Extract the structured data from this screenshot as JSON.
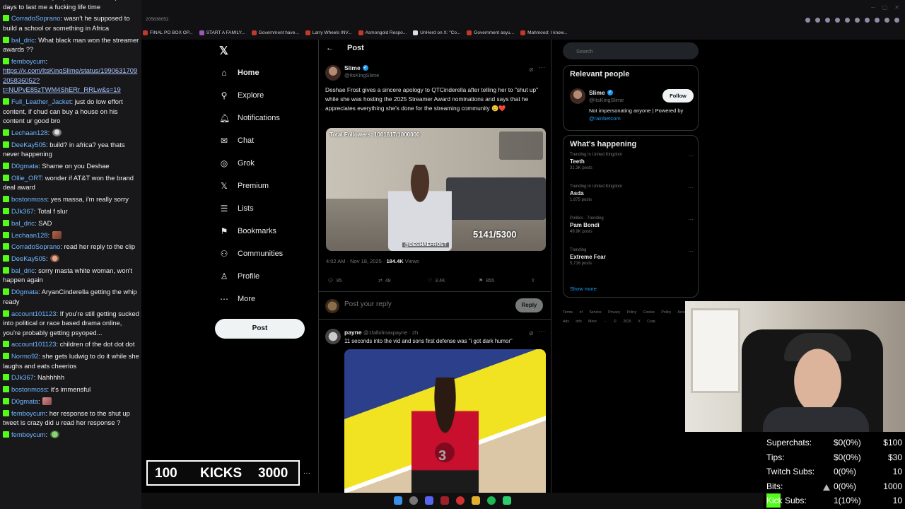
{
  "chat": {
    "messages": [
      {
        "user": "",
        "text": "obnoxious black people in the last couple days to last me a fucking life time",
        "emote": ""
      },
      {
        "user": "CorradoSoprano",
        "text": "wasn't he supposed to build a school or something in Africa",
        "emote": ""
      },
      {
        "user": "bal_dric",
        "text": "What black man won the streamer awards ??",
        "emote": ""
      },
      {
        "user": "femboycum",
        "link": "https://x.com/ItsKingSlime/status/1990631709205836052?t=NUPvE85zTWM4ShERr_RRLw&s=19",
        "text": "",
        "emote": ""
      },
      {
        "user": "Full_Leather_Jacket",
        "text": "just do low effort content, if chud can buy a house on his content ur good bro",
        "emote": ""
      },
      {
        "user": "Lechaan128",
        "text": "",
        "emote": "e1"
      },
      {
        "user": "DeeKay505",
        "text": "build? in africa? yea thats never happening",
        "emote": ""
      },
      {
        "user": "D0gmata",
        "text": "Shame on you Deshae",
        "emote": ""
      },
      {
        "user": "Ollie_ORT",
        "text": "wonder if AT&T won the brand deal award",
        "emote": ""
      },
      {
        "user": "bostonmoss",
        "text": "yes massa, i'm really sorry",
        "emote": ""
      },
      {
        "user": "DJk367",
        "text": "Total f slur",
        "emote": ""
      },
      {
        "user": "bal_dric",
        "text": "SAD",
        "emote": ""
      },
      {
        "user": "Lechaan128",
        "text": "",
        "emote": "e2"
      },
      {
        "user": "CorradoSoprano",
        "text": "read her reply to the clip",
        "emote": ""
      },
      {
        "user": "DeeKay505",
        "text": "",
        "emote": "e3"
      },
      {
        "user": "bal_dric",
        "text": "sorry masta white woman, won't happen again",
        "emote": ""
      },
      {
        "user": "D0gmata",
        "text": "AryanCinderella getting the whip ready",
        "emote": ""
      },
      {
        "user": "account101123",
        "text": "If you're still getting sucked into political or race based drama online, you're probably getting psyoped...",
        "emote": ""
      },
      {
        "user": "account101123",
        "text": "children of the dot dot dot",
        "emote": ""
      },
      {
        "user": "Normo92",
        "text": "she gets ludwig to do it while she laughs and eats cheerios",
        "emote": ""
      },
      {
        "user": "DJk367",
        "text": "Nahhhhh",
        "emote": ""
      },
      {
        "user": "bostonmoss",
        "text": "it's immensful",
        "emote": ""
      },
      {
        "user": "D0gmata",
        "text": "",
        "emote": "e4"
      },
      {
        "user": "femboycum",
        "text": "her response to the shut up tweet is crazy did u read her response ?",
        "emote": ""
      },
      {
        "user": "femboycum",
        "text": "",
        "emote": "e5"
      }
    ]
  },
  "browser": {
    "url_fragment": "205836052",
    "bookmarks": [
      {
        "label": "FINAL PO BOX OP...",
        "color": "#c0392b"
      },
      {
        "label": "START A FAMILY...",
        "color": "#9b59b6"
      },
      {
        "label": "Government have...",
        "color": "#c0392b"
      },
      {
        "label": "Larry Wheels INV...",
        "color": "#c0392b"
      },
      {
        "label": "Asmongold Respo...",
        "color": "#c0392b"
      },
      {
        "label": "UnHerd on X: \"Co...",
        "color": "#dddddd"
      },
      {
        "label": "Government asyu...",
        "color": "#c0392b"
      },
      {
        "label": "Mahmood: I know...",
        "color": "#c0392b"
      }
    ]
  },
  "nav": {
    "logo": "𝕏",
    "items": [
      {
        "label": "Home",
        "icon": "⌂",
        "name": "home"
      },
      {
        "label": "Explore",
        "icon": "⚲",
        "name": "explore"
      },
      {
        "label": "Notifications",
        "icon": "🔔︎",
        "name": "notifications"
      },
      {
        "label": "Chat",
        "icon": "✉",
        "name": "chat"
      },
      {
        "label": "Grok",
        "icon": "◎",
        "name": "grok"
      },
      {
        "label": "Premium",
        "icon": "𝕏",
        "name": "premium"
      },
      {
        "label": "Lists",
        "icon": "☰",
        "name": "lists"
      },
      {
        "label": "Bookmarks",
        "icon": "⚑",
        "name": "bookmarks"
      },
      {
        "label": "Communities",
        "icon": "⚇",
        "name": "communities"
      },
      {
        "label": "Profile",
        "icon": "♙",
        "name": "profile"
      },
      {
        "label": "More",
        "icon": "⋯",
        "name": "more"
      }
    ],
    "post_button": "Post"
  },
  "post": {
    "header": "Post",
    "back": "←",
    "author_name": "Slime",
    "author_handle": "@ItsKingSlime",
    "text": "Deshae Frost gives a sincere apology to QTCinderella after telling her to \"shut up\" while she was hosting the 2025 Streamer Award nominations and says that he appreciates everything she's done for the streaming community 😢❤️",
    "media_top": "Total Followers: 1001617/1000000",
    "media_count": "5141/5300",
    "media_tag": "@DESHAEFROST",
    "time": "4:02 AM · Nov 18, 2025 ·",
    "views_num": "184.4K",
    "views_label": "Views",
    "replies": "85",
    "reposts": "48",
    "likes": "3.4K",
    "bookmarks": "855",
    "reply_placeholder": "Post your reply",
    "reply_button": "Reply"
  },
  "reply": {
    "name": "payne",
    "handle": "@1fallofmaxpayne · 2h",
    "text": "11 seconds into the vid and sons first defense was \"i got dark humor\"",
    "jersey": "3"
  },
  "sidebar": {
    "search_placeholder": "Search",
    "relevant_title": "Relevant people",
    "rel_name": "Slime",
    "rel_handle": "@ItsKingSlime",
    "rel_desc": "Not impersonating anyone | Powered by",
    "rel_link": "@rainbetcom",
    "follow": "Follow",
    "happening_title": "What's happening",
    "trends": [
      {
        "context": "Trending in United Kingdom",
        "name": "Teeth",
        "posts": "31.3K posts"
      },
      {
        "context": "Trending in United Kingdom",
        "name": "Asda",
        "posts": "1,875 posts"
      },
      {
        "context": "Politics · Trending",
        "name": "Pam Bondi",
        "posts": "49.9K posts"
      },
      {
        "context": "Trending",
        "name": "Extreme Fear",
        "posts": "5,716 posts"
      }
    ],
    "show_more": "Show more",
    "footer": "Terms of Service Privacy Policy Cookie Policy Accessibility Ads info More ··· © 2025 X Corp."
  },
  "goals": [
    {
      "label": "Superchats:",
      "value": "$0(0%)",
      "target": "$100"
    },
    {
      "label": "Tips:",
      "value": "$0(0%)",
      "target": "$30"
    },
    {
      "label": "Twitch Subs:",
      "value": "0(0%)",
      "target": "10"
    },
    {
      "label": "Bits:",
      "value": "0(0%)",
      "target": "1000"
    },
    {
      "label": "Kick Subs:",
      "value": "1(10%)",
      "target": "10"
    }
  ],
  "kicks": {
    "left": "100",
    "mid": "KICKS",
    "right": "3000",
    "dots": "···"
  },
  "colors": {
    "kick_green": "#53fc18",
    "x_blue": "#1d9bf0"
  }
}
